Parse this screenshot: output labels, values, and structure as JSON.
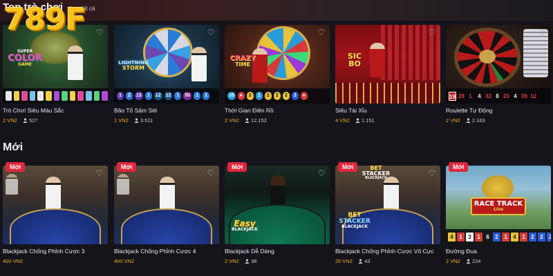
{
  "brand": {
    "logo_text": "789F"
  },
  "top_section": {
    "title": "Top trò chơi",
    "view_all": "Xem tất cả"
  },
  "new_section": {
    "title": "Mới"
  },
  "new_badge": "Mới",
  "top_games": [
    {
      "title": "Trò Chơi Siêu Màu Sắc",
      "bet": "2 VN2",
      "players": "527",
      "logo": [
        "SUPER",
        "COLOR",
        "GAME"
      ],
      "strip": []
    },
    {
      "title": "Bão Tố Sấm Sét",
      "bet": "1 VN2",
      "players": "3.511",
      "logo": [
        "LIGHTNING",
        "STORM"
      ],
      "strip": [
        "1",
        "2",
        "13",
        "1",
        "12",
        "12",
        "1",
        "50",
        "1",
        "1"
      ]
    },
    {
      "title": "Thời Gian Điên Rồ",
      "bet": "2 VN2",
      "players": "12.152",
      "logo": [
        "CRAZY",
        "TIME"
      ],
      "strip": [
        "10",
        "2",
        "1",
        "2",
        "2",
        "2",
        "2"
      ]
    },
    {
      "title": "Siêu Tài Xỉu",
      "bet": "4 VN2",
      "players": "1.151",
      "logo": [
        "SIC",
        "BO"
      ],
      "strip": []
    },
    {
      "title": "Roulette Tự Động",
      "bet": "2 VN2",
      "players": "2.163",
      "logo": [],
      "strip": [
        "19",
        "28",
        "1",
        "4",
        "32",
        "8",
        "23",
        "4",
        "36",
        "12"
      ]
    }
  ],
  "new_games": [
    {
      "title": "Blackjack Chống Phỉnh Cược 3",
      "bet": "400 VN2",
      "players": "",
      "logo": [],
      "strip": []
    },
    {
      "title": "Blackjack Chống Phỉnh Cược 4",
      "bet": "400 VN2",
      "players": "",
      "logo": [],
      "strip": []
    },
    {
      "title": "Blackjack Dễ Dàng",
      "bet": "2 VN2",
      "players": "38",
      "logo": [
        "Easy",
        "BLACKJACK"
      ],
      "strip": []
    },
    {
      "title": "Blackjack Chống Phỉnh Cược Vô Cực",
      "bet": "20 VN2",
      "players": "43",
      "logo": [
        "BET",
        "STACKER",
        "BLACKJACK"
      ],
      "strip": []
    },
    {
      "title": "Đường Đua",
      "bet": "2 VN2",
      "players": "224",
      "logo": [
        "RACE TRACK",
        "Live"
      ],
      "strip": [
        "4",
        "1",
        "3",
        "1",
        "6",
        "2",
        "1",
        "4",
        "1",
        "2",
        "2",
        "2"
      ]
    }
  ],
  "colors": {
    "background": "#15141b",
    "accent_gold": "#f2b21b",
    "badge_red": "#e0263c",
    "logo_yellow": "#f7c21a"
  },
  "icons": {
    "favorite": "heart-outline-icon",
    "players": "user-icon"
  }
}
